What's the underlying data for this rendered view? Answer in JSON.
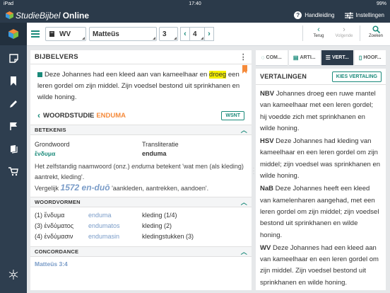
{
  "status_bar": {
    "device": "iPad",
    "time": "17:40",
    "battery": "99%"
  },
  "app": {
    "title_italic": "StudieBijbel",
    "title_bold": "Online",
    "help_label": "Handleiding",
    "settings_label": "Instellingen"
  },
  "toolbar": {
    "translation": "WV",
    "book": "Matteüs",
    "chapter": "3",
    "verse": "4",
    "back_label": "Terug",
    "forward_label": "Volgende",
    "search_label": "Zoeken"
  },
  "main_panel": {
    "title": "BIJBELVERS",
    "verse_before": "Deze Johannes had een kleed aan van kameelhaar en ",
    "verse_highlight": "droeg",
    "verse_after": " een leren gordel om zijn middel. Zijn voedsel bestond uit sprinkhanen en wilde honing.",
    "word_study_label": "WOORDSTUDIE",
    "word_study_word": "ENDUMA",
    "wsnt_label": "WSNT",
    "meaning_section": "BETEKENIS",
    "root_word_label": "Grondwoord",
    "transliteration_label": "Transliteratie",
    "root_word": "ἔνδυμα",
    "transliteration": "enduma",
    "meaning_text_1": "Het zelfstandig naamwoord (onz.) ",
    "meaning_text_em": "enduma",
    "meaning_text_2": " betekent 'wat men (als kleding) aantrekt, kleding'.",
    "compare_label": "Vergelijk ",
    "compare_ref": "1572 en-duō",
    "compare_text": " 'aankleden, aantrekken, aandoen'.",
    "word_forms_section": "WOORDVORMEN",
    "word_forms": [
      {
        "num": "(1) ἔνδυμα",
        "translit": "enduma",
        "meaning": "kleding (1/4)"
      },
      {
        "num": "(3) ἐνδύματος",
        "translit": "endumatos",
        "meaning": "kleding (2)"
      },
      {
        "num": "(4) ἐνδύμασιν",
        "translit": "endumasin",
        "meaning": "kledingstukken (3)"
      }
    ],
    "concordance_section": "CONCORDANCE",
    "concordance_ref": "Matteüs 3:4"
  },
  "right_tabs": [
    {
      "label": "COM...",
      "icon": "comment-icon"
    },
    {
      "label": "ARTI...",
      "icon": "article-icon"
    },
    {
      "label": "VERT...",
      "icon": "list-icon"
    },
    {
      "label": "HOOF...",
      "icon": "document-icon"
    }
  ],
  "right_panel": {
    "title": "VERTALINGEN",
    "choose_label": "KIES VERTALING",
    "translations": [
      {
        "code": "NBV",
        "text": " Johannes droeg een ruwe mantel van kameelhaar met een leren gordel; hij voedde zich met sprinkhanen en wilde honing."
      },
      {
        "code": "HSV",
        "text": " Deze Johannes had kleding van kameelhaar en een leren gordel om zijn middel; zijn voedsel was sprinkhanen en wilde honing."
      },
      {
        "code": "NaB",
        "text": " Deze Johannes heeft een kleed van kamelenharen aangehad, met een leren gordel om zijn middel; zijn voedsel bestond uit sprinkhanen en wilde honing."
      },
      {
        "code": "WV",
        "text": " Deze Johannes had een kleed aan van kameelhaar en een leren gordel om zijn middel. Zijn voedsel bestond uit sprinkhanen en wilde honing."
      }
    ]
  },
  "colors": {
    "header": "#2b3a4a",
    "accent": "#1a8a7a",
    "highlight": "#f5f000",
    "orange": "#f58a3a"
  }
}
